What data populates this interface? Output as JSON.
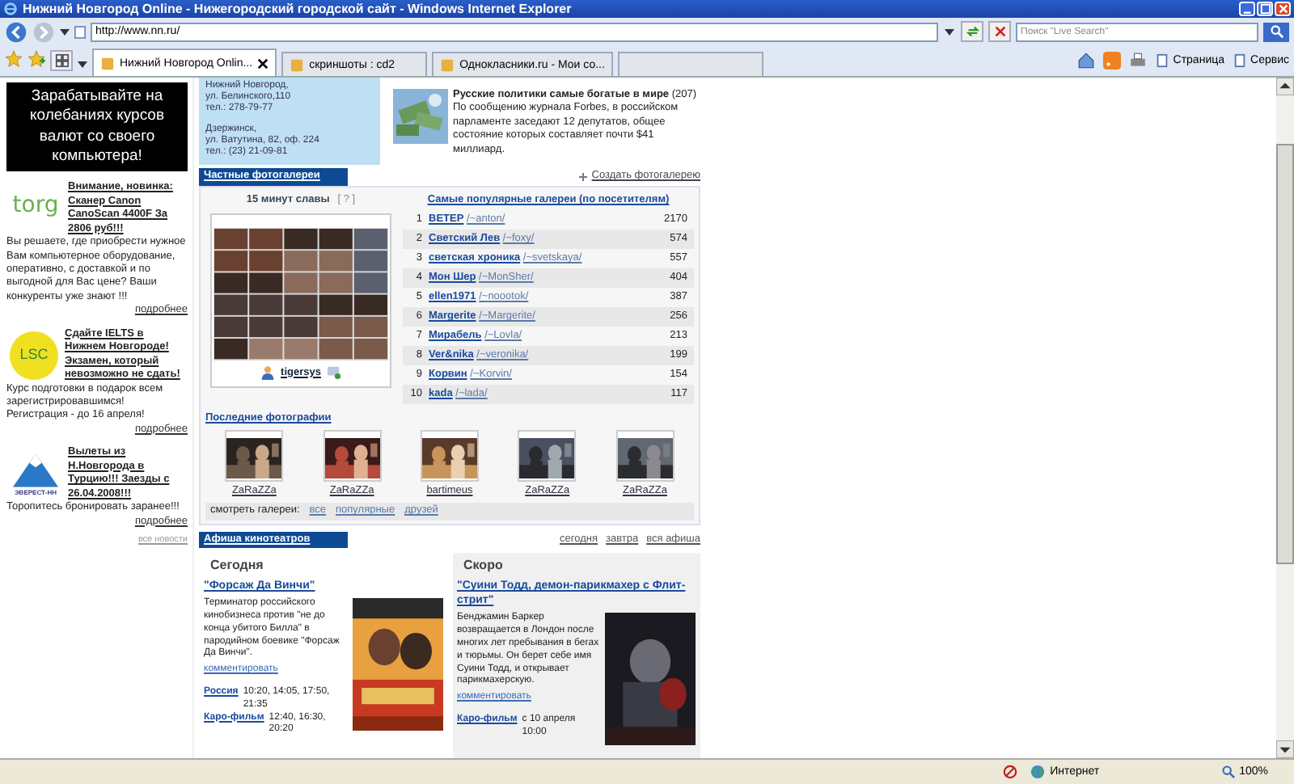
{
  "window": {
    "title": "Нижний Новгород Online - Нижегородский городской сайт - Windows Internet Explorer"
  },
  "address_bar": {
    "url": "http://www.nn.ru/"
  },
  "search": {
    "placeholder": "Поиск \"Live Search\""
  },
  "tabs": [
    {
      "label": "Нижний Новгород Onlin...",
      "selected": true
    },
    {
      "label": "скриншоты : cd2",
      "selected": false
    },
    {
      "label": "Однокласники.ru - Мои со...",
      "selected": false
    }
  ],
  "command_bar": [
    {
      "label": "Страница"
    },
    {
      "label": "Сервис"
    }
  ],
  "left_ads": {
    "banner": "Зарабатывайте на колебаниях курсов валют со своего компьютера!",
    "items": [
      {
        "kind": "torg",
        "logo_text": "torg",
        "title": "Внимание, новинка: Сканер Canon CanoScan 4400F За 2806 руб!!!",
        "text": "Вы решаете, где приобрести нужное Вам компьютерное оборудование, оперативно, с доставкой и по выгодной для Вас цене? Ваши конкуренты уже знают !!!",
        "more": "подробнее"
      },
      {
        "kind": "lsc",
        "logo_text": "LSC",
        "title": "Сдайте IELTS в Нижнем Новгороде! Экзамен, который невозможно не сдать!",
        "text": "Курс подготовки в подарок всем зарегистрировавшимся! Регистрация - до 16 апреля!",
        "more": "подробнее"
      },
      {
        "kind": "everest",
        "logo_text": "ЭВЕРЕСТ-НН",
        "title": "Вылеты из Н.Новгорода в Турцию!!! Заезды с 26.04.2008!!!",
        "text": "Торопитесь бронировать заранее!!!",
        "more": "подробнее"
      }
    ],
    "all_news": "все новости"
  },
  "contacts": [
    [
      "Нижний Новгород,",
      "ул. Белинского,110",
      "тел.: 278-79-77"
    ],
    [
      "Дзержинск,",
      "ул. Ватутина, 82, оф. 224",
      "тел.: (23) 21-09-81"
    ]
  ],
  "news": {
    "title": "Русские политики самые богатые в мире",
    "count": "(207)",
    "text": "По сообщению журнала Forbes, в российском парламенте заседают 12 депутатов, общее состояние которых составляет почти $41 миллиард."
  },
  "galleries": {
    "title": "Частные фотогалереи",
    "create": "Создать фотогалерею",
    "fame_title": "15 минут славы",
    "help": "[ ? ]",
    "fame_user": "tigersys",
    "popular_title": "Самые популярные галереи (по посетителям)",
    "rows": [
      {
        "rank": "1",
        "name": "ВЕТЕР",
        "path": "/~anton/",
        "count": "2170"
      },
      {
        "rank": "2",
        "name": "Светский Лев",
        "path": "/~foxy/",
        "count": "574"
      },
      {
        "rank": "3",
        "name": "светская хроника",
        "path": "/~svetskaya/",
        "count": "557"
      },
      {
        "rank": "4",
        "name": "Мон Шер",
        "path": "/~MonSher/",
        "count": "404"
      },
      {
        "rank": "5",
        "name": "ellen1971",
        "path": "/~noootok/",
        "count": "387"
      },
      {
        "rank": "6",
        "name": "Margerite",
        "path": "/~Margerite/",
        "count": "256"
      },
      {
        "rank": "7",
        "name": "Мирабель",
        "path": "/~Lovla/",
        "count": "213"
      },
      {
        "rank": "8",
        "name": "Ver&nika",
        "path": "/~veronika/",
        "count": "199"
      },
      {
        "rank": "9",
        "name": "Корвин",
        "path": "/~Korvin/",
        "count": "154"
      },
      {
        "rank": "10",
        "name": "kada",
        "path": "/~lada/",
        "count": "117"
      }
    ],
    "recent_title": "Последние фотографии",
    "recent": [
      "ZaRaZZa",
      "ZaRaZZa",
      "bartimeus",
      "ZaRaZZa",
      "ZaRaZZa"
    ],
    "view_label": "смотреть галереи:",
    "view_links": [
      "все",
      "популярные",
      "друзей"
    ]
  },
  "cinema": {
    "title": "Афиша кинотеатров",
    "links": [
      "сегодня",
      "завтра",
      "вся афиша"
    ],
    "columns": [
      {
        "heading": "Сегодня",
        "movie": "\"Форсаж Да Винчи\"",
        "text": "Терминатор российского кинобизнеса против \"не до конца убитого Билла\" в пародийном боевике \"Форсаж Да Винчи\".",
        "comment": "комментировать",
        "showings": [
          {
            "cinema": "Россия",
            "times": "10:20, 14:05, 17:50, 21:35"
          },
          {
            "cinema": "Каро-фильм",
            "times": "12:40, 16:30, 20:20"
          }
        ]
      },
      {
        "heading": "Скоро",
        "movie": "\"Суини Тодд, демон-парикмахер с Флит-стрит\"",
        "text": "Бенджамин Баркер возвращается в Лондон после многих лет пребывания в бегах и тюрьмы. Он берет себе имя Суини Тодд, и открывает парикмахерскую.",
        "comment": "комментировать",
        "showings": [
          {
            "cinema": "Каро-фильм",
            "times": "с 10 апреля 10:00"
          }
        ]
      }
    ]
  },
  "status_bar": {
    "zone": "Интернет",
    "zoom": "100%"
  }
}
